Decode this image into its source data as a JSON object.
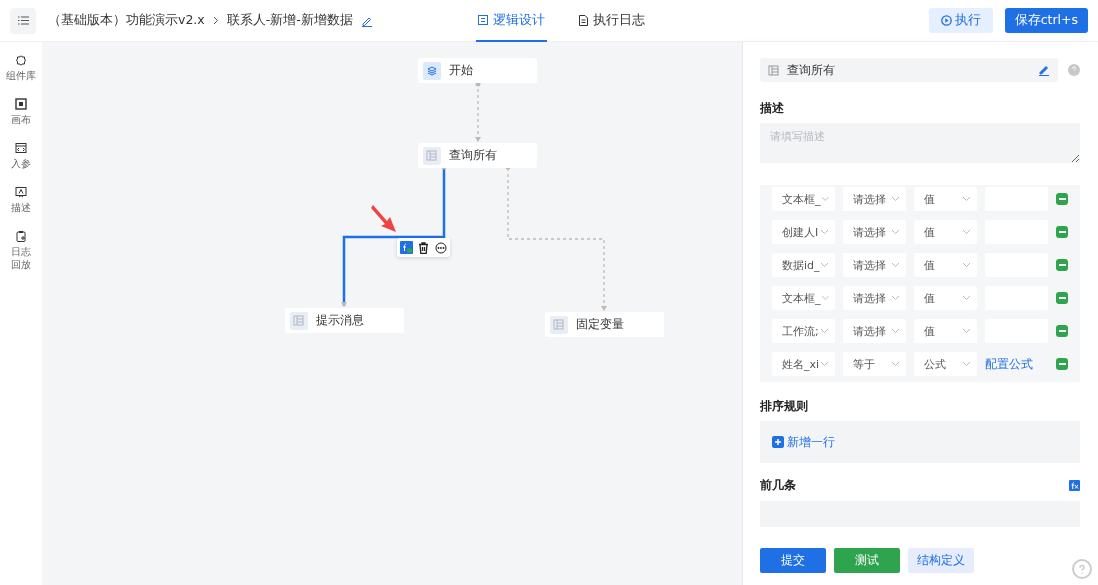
{
  "header": {
    "breadcrumb": [
      "（基础版本）功能演示v2.x",
      "联系人-新增-新增数据"
    ],
    "tabs": [
      {
        "label": "逻辑设计",
        "selected": true
      },
      {
        "label": "执行日志",
        "selected": false
      }
    ],
    "run_button": "执行",
    "save_button": "保存ctrl+s"
  },
  "sidebar": {
    "items": [
      {
        "label": "组件库"
      },
      {
        "label": "画布"
      },
      {
        "label": "入参"
      },
      {
        "label": "描述"
      },
      {
        "label": "日志回放"
      }
    ]
  },
  "canvas": {
    "nodes": [
      {
        "label": "开始",
        "kind": "start"
      },
      {
        "label": "查询所有",
        "kind": "table"
      },
      {
        "label": "提示消息",
        "kind": "table"
      },
      {
        "label": "固定变量",
        "kind": "table"
      }
    ],
    "edges": [
      {
        "selected": false
      },
      {
        "selected": true
      },
      {
        "selected": false
      }
    ]
  },
  "panel": {
    "node_name": "查询所有",
    "description_label": "描述",
    "description_placeholder": "请填写描述",
    "conditions": [
      {
        "kind": "value",
        "field": "文本框_",
        "operator": "请选择",
        "value_type": "值"
      },
      {
        "kind": "value",
        "field": "创建人I",
        "operator": "请选择",
        "value_type": "值"
      },
      {
        "kind": "value",
        "field": "数据id_",
        "operator": "请选择",
        "value_type": "值"
      },
      {
        "kind": "value",
        "field": "文本框_",
        "operator": "请选择",
        "value_type": "值"
      },
      {
        "kind": "value",
        "field": "工作流;",
        "operator": "请选择",
        "value_type": "值"
      },
      {
        "kind": "formula",
        "field": "姓名_xi",
        "operator": "等于",
        "value_type": "公式",
        "link": "配置公式"
      }
    ],
    "sort_label": "排序规则",
    "add_row": "新增一行",
    "limit_label": "前几条",
    "buttons": {
      "submit": "提交",
      "test": "测试",
      "schema": "结构定义"
    }
  }
}
